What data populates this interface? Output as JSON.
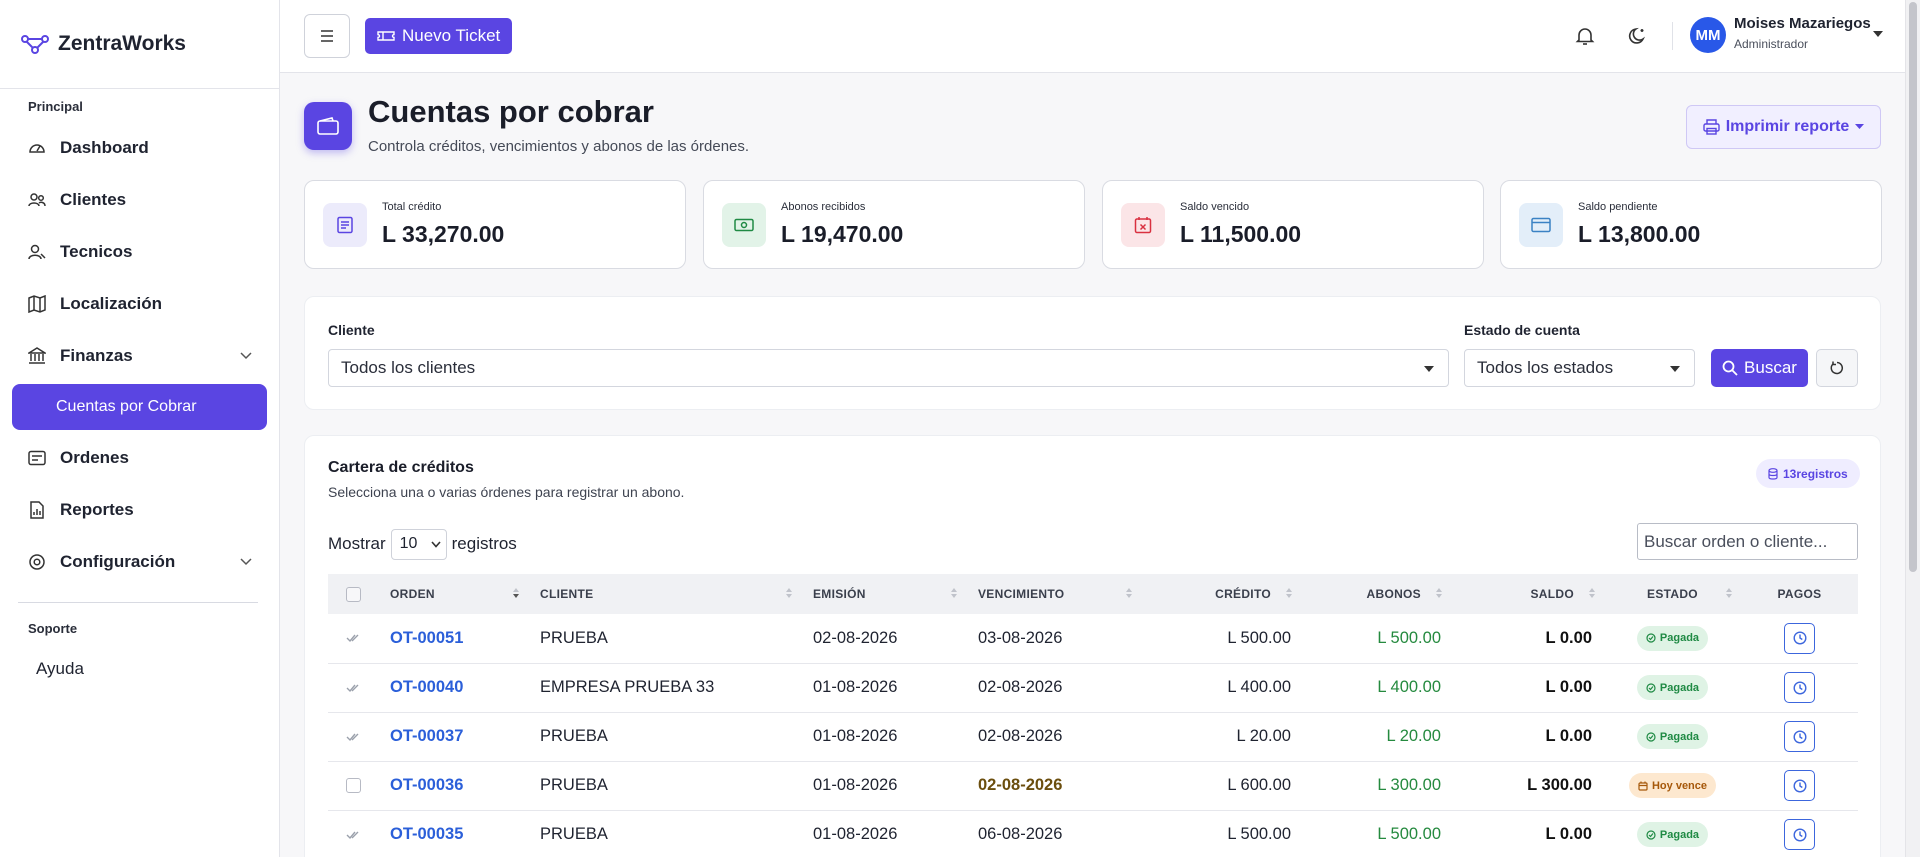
{
  "brand": {
    "name": "ZentraWorks"
  },
  "sidebar": {
    "section_principal": "Principal",
    "items": [
      {
        "label": "Dashboard",
        "icon": "gauge-icon"
      },
      {
        "label": "Clientes",
        "icon": "users-icon"
      },
      {
        "label": "Tecnicos",
        "icon": "user-icon"
      },
      {
        "label": "Localización",
        "icon": "map-icon"
      },
      {
        "label": "Finanzas",
        "icon": "bank-icon"
      },
      {
        "label": "Ordenes",
        "icon": "orders-icon"
      },
      {
        "label": "Reportes",
        "icon": "report-icon"
      },
      {
        "label": "Configuración",
        "icon": "gear-icon"
      }
    ],
    "finanzas_sub": "Cuentas por Cobrar",
    "section_soporte": "Soporte",
    "ayuda": "Ayuda"
  },
  "topbar": {
    "new_ticket": "Nuevo Ticket",
    "user_name": "Moises Mazariegos",
    "user_role": "Administrador",
    "initials": "MM"
  },
  "header": {
    "title": "Cuentas por cobrar",
    "subtitle": "Controla créditos, vencimientos y abonos de las órdenes.",
    "print": "Imprimir reporte"
  },
  "stats": [
    {
      "label": "Total crédito",
      "value": "L 33,270.00",
      "color": "#5a45e2",
      "bg": "#ecebfb"
    },
    {
      "label": "Abonos recibidos",
      "value": "L 19,470.00",
      "color": "#1f8a44",
      "bg": "#e2f3e8"
    },
    {
      "label": "Saldo vencido",
      "value": "L 11,500.00",
      "color": "#d93040",
      "bg": "#fbe5e7"
    },
    {
      "label": "Saldo pendiente",
      "value": "L 13,800.00",
      "color": "#3b82c4",
      "bg": "#e3eef9"
    }
  ],
  "filters": {
    "cliente_label": "Cliente",
    "cliente_value": "Todos los clientes",
    "estado_label": "Estado de cuenta",
    "estado_value": "Todos los estados",
    "buscar": "Buscar"
  },
  "table": {
    "title": "Cartera de créditos",
    "subtitle": "Selecciona una o varias órdenes para registrar un abono.",
    "count": "13registros",
    "mostrar": "Mostrar",
    "page_size": "10",
    "registros": "registros",
    "search_placeholder": "Buscar orden o cliente...",
    "columns": [
      "ORDEN",
      "CLIENTE",
      "EMISIÓN",
      "VENCIMIENTO",
      "CRÉDITO",
      "ABONOS",
      "SALDO",
      "ESTADO",
      "PAGOS"
    ],
    "rows": [
      {
        "orden": "OT-00051",
        "cliente": "PRUEBA",
        "emision": "02-08-2026",
        "vencimiento": "03-08-2026",
        "credito": "L 500.00",
        "abonos": "L 500.00",
        "saldo": "L 0.00",
        "estado": "Pagada",
        "status": "paid"
      },
      {
        "orden": "OT-00040",
        "cliente": "EMPRESA PRUEBA 33",
        "emision": "01-08-2026",
        "vencimiento": "02-08-2026",
        "credito": "L 400.00",
        "abonos": "L 400.00",
        "saldo": "L 0.00",
        "estado": "Pagada",
        "status": "paid"
      },
      {
        "orden": "OT-00037",
        "cliente": "PRUEBA",
        "emision": "01-08-2026",
        "vencimiento": "02-08-2026",
        "credito": "L 20.00",
        "abonos": "L 20.00",
        "saldo": "L 0.00",
        "estado": "Pagada",
        "status": "paid"
      },
      {
        "orden": "OT-00036",
        "cliente": "PRUEBA",
        "emision": "01-08-2026",
        "vencimiento": "02-08-2026",
        "credito": "L 600.00",
        "abonos": "L 300.00",
        "saldo": "L 300.00",
        "estado": "Hoy vence",
        "status": "due"
      },
      {
        "orden": "OT-00035",
        "cliente": "PRUEBA",
        "emision": "01-08-2026",
        "vencimiento": "06-08-2026",
        "credito": "L 500.00",
        "abonos": "L 500.00",
        "saldo": "L 0.00",
        "estado": "Pagada",
        "status": "paid"
      }
    ]
  }
}
